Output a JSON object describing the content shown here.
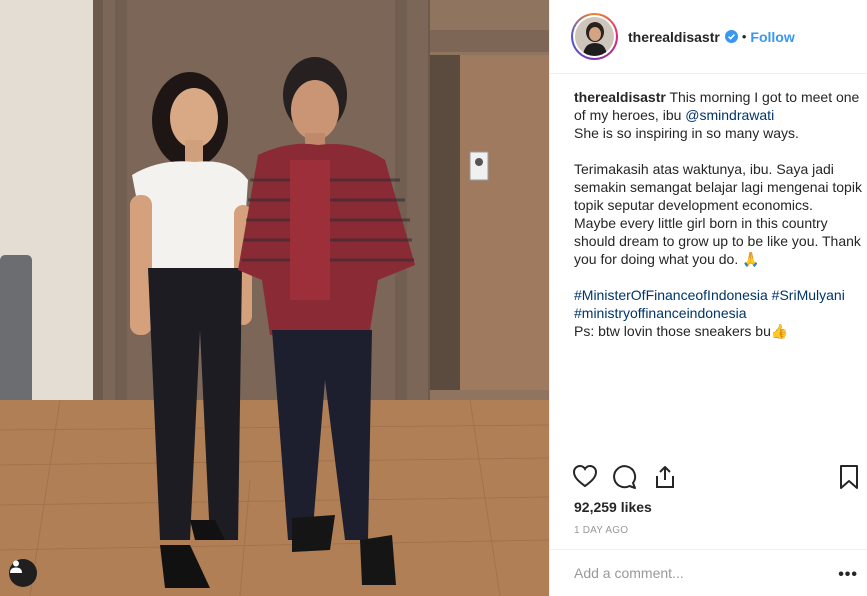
{
  "post": {
    "username": "therealdisastr",
    "follow_label": "Follow",
    "separator": "•",
    "caption_first_line": "This morning I got to meet one of my heroes, ibu ",
    "caption_mention": "@smindrawati",
    "caption_lines": [
      "She is so inspiring in so many ways.",
      "",
      "Terimakasih atas waktunya, ibu. Saya jadi semakin semangat belajar lagi mengenai topik topik seputar development economics.",
      "Maybe every little girl born in this country should dream to grow up to be like you. Thank you for doing what you do. 🙏",
      ""
    ],
    "hashtags": [
      "#MinisterOfFinanceofIndonesia",
      "#SriMulyani",
      "#ministryoffinanceindonesia"
    ],
    "ps_line": "Ps: btw lovin those sneakers bu👍",
    "likes": "92,259 likes",
    "time": "1 DAY AGO",
    "comment_placeholder": "Add a comment...",
    "more_label": "•••"
  },
  "icons": {
    "verified": "verified-badge-icon",
    "like": "heart-icon",
    "comment": "comment-bubble-icon",
    "share": "share-icon",
    "save": "bookmark-icon",
    "tag": "user-tag-icon"
  },
  "colors": {
    "accent": "#3897f0",
    "mention": "#003569",
    "muted": "#999999"
  }
}
